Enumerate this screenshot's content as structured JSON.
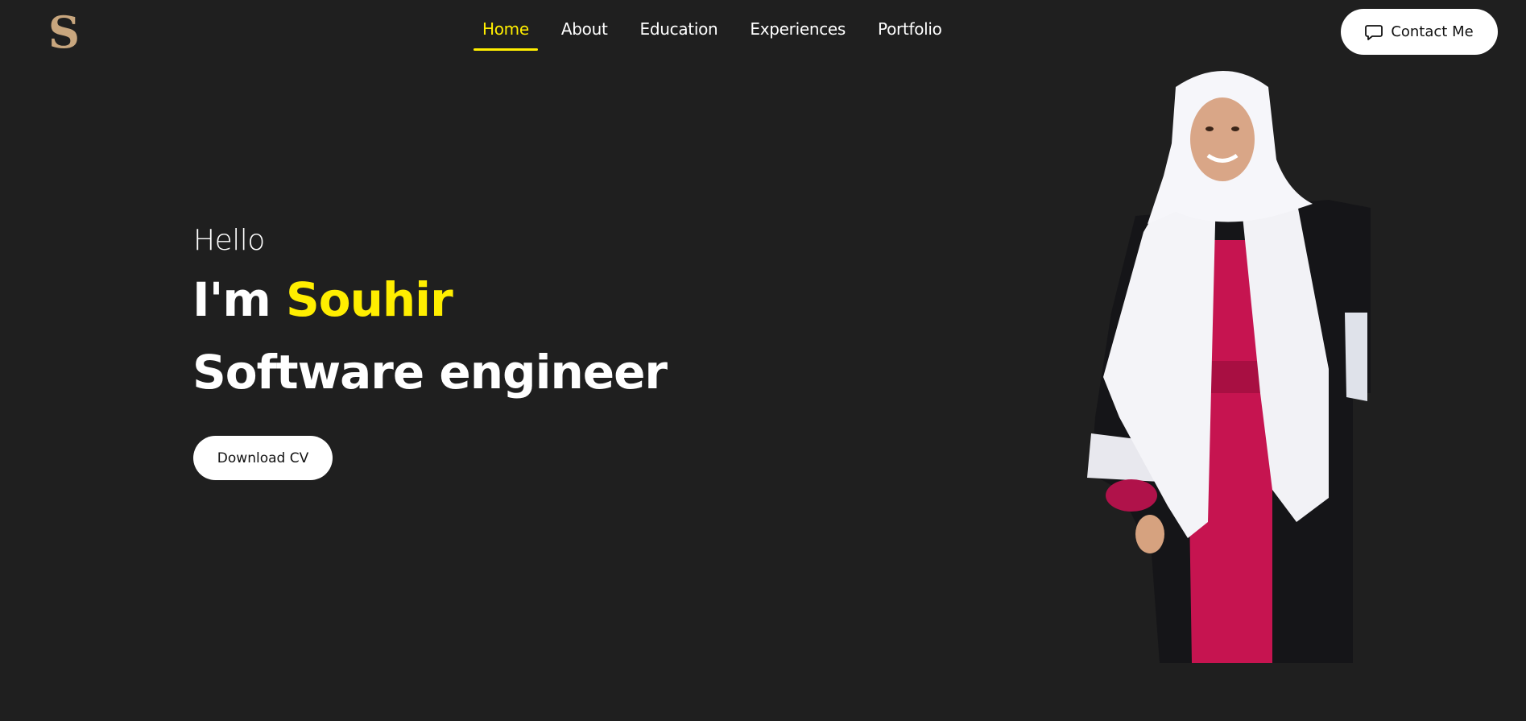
{
  "header": {
    "logo": "S",
    "nav": [
      {
        "label": "Home",
        "active": true
      },
      {
        "label": "About",
        "active": false
      },
      {
        "label": "Education",
        "active": false
      },
      {
        "label": "Experiences",
        "active": false
      },
      {
        "label": "Portfolio",
        "active": false
      }
    ],
    "contact_label": "Contact Me",
    "contact_icon": "chat-bubble-icon"
  },
  "hero": {
    "greeting": "Hello",
    "intro_prefix": "I'm",
    "name": "Souhir",
    "role": "Software engineer",
    "cta_label": "Download CV"
  },
  "colors": {
    "background": "#1f1f1f",
    "accent": "#ffee00",
    "logo": "#c8a67e",
    "button_bg": "#ffffff"
  }
}
